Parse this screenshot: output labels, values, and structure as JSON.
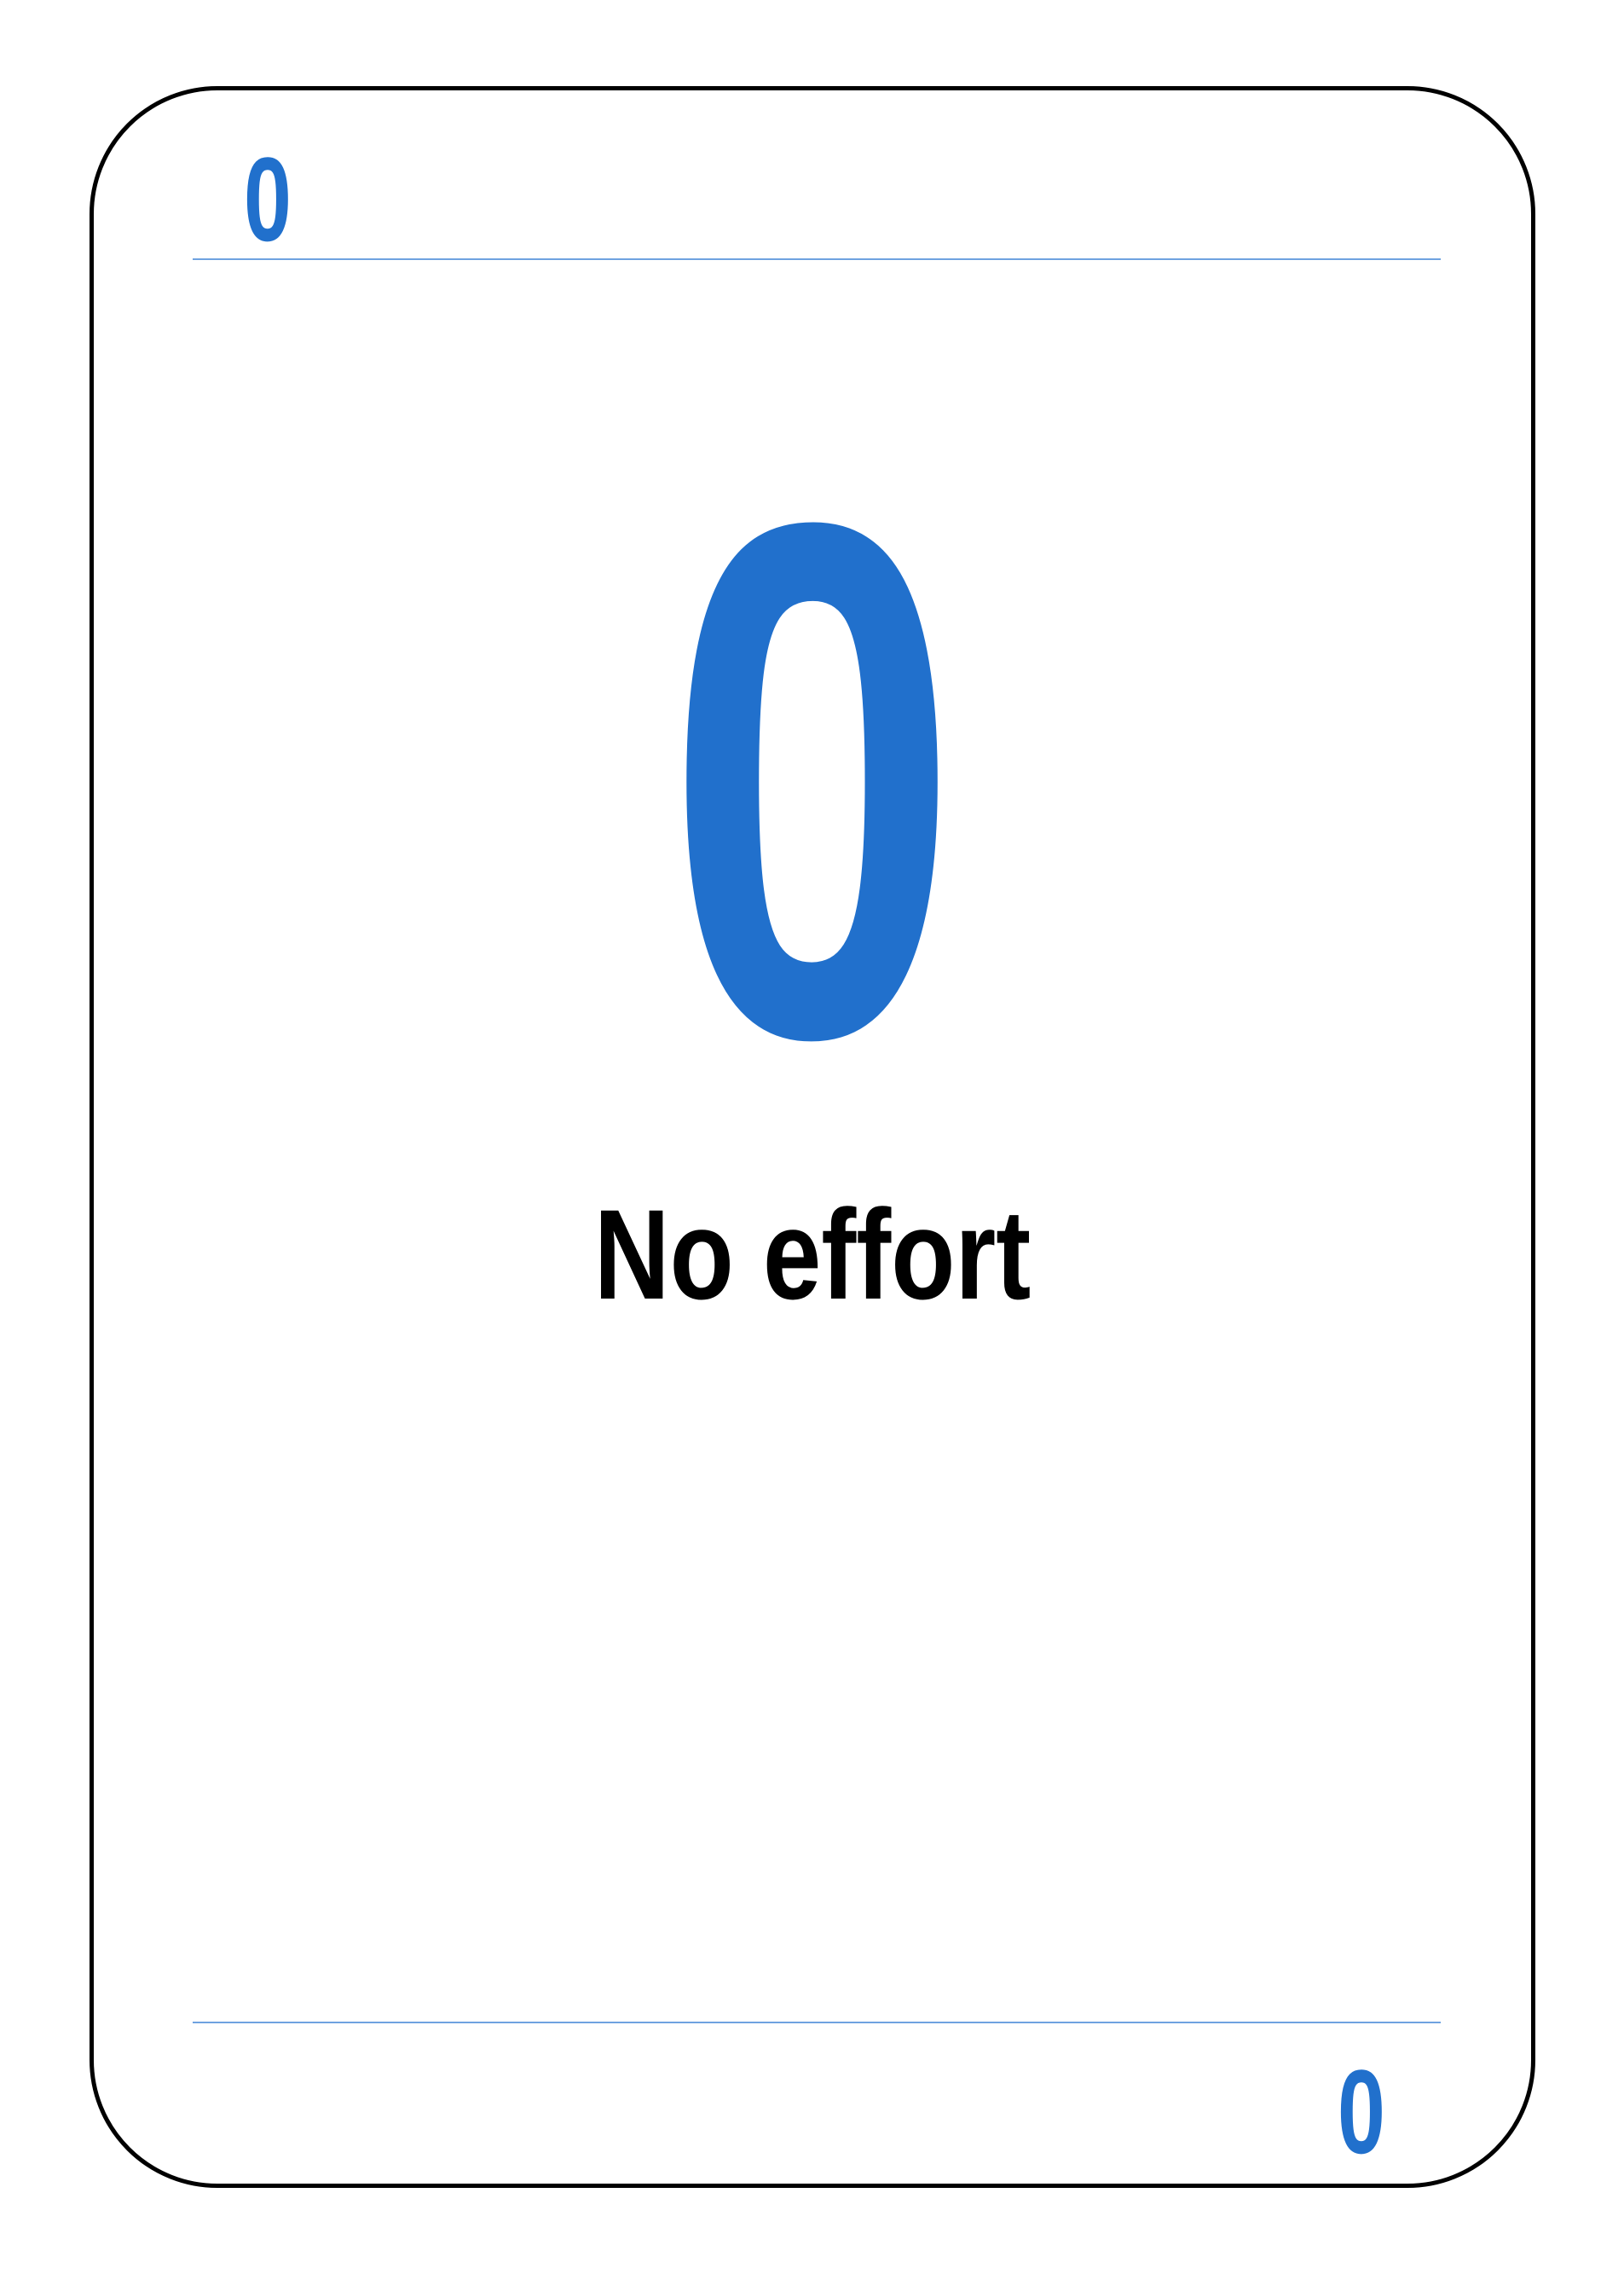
{
  "card": {
    "value": "0",
    "label": "No effort",
    "accent_color": "#2170cc",
    "border_color": "#000000",
    "divider_color": "#6fa2e0"
  }
}
